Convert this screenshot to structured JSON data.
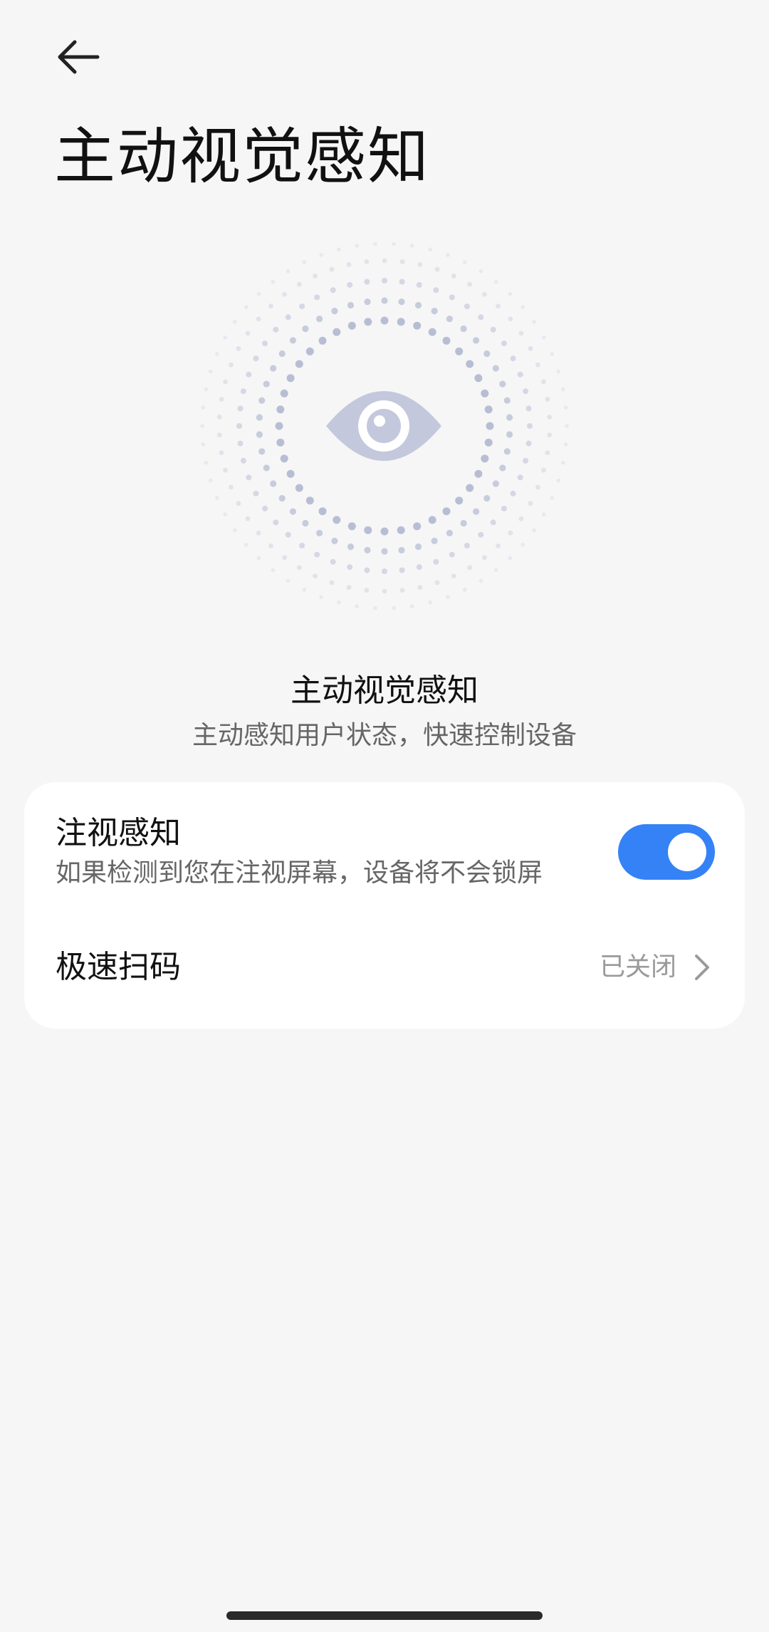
{
  "header": {
    "back_icon": "back-arrow-icon",
    "title": "主动视觉感知"
  },
  "hero": {
    "icon": "eye-icon",
    "title": "主动视觉感知",
    "subtitle": "主动感知用户状态，快速控制设备"
  },
  "settings": {
    "gaze": {
      "title": "注视感知",
      "description": "如果检测到您在注视屏幕，设备将不会锁屏",
      "enabled": true
    },
    "quick_scan": {
      "title": "极速扫码",
      "value": "已关闭",
      "icon": "chevron-right-icon"
    }
  },
  "colors": {
    "background": "#f6f6f6",
    "card": "#ffffff",
    "accent": "#3482f6",
    "hero_dots": "#b3bad2",
    "eye": "#c3c8dc"
  }
}
